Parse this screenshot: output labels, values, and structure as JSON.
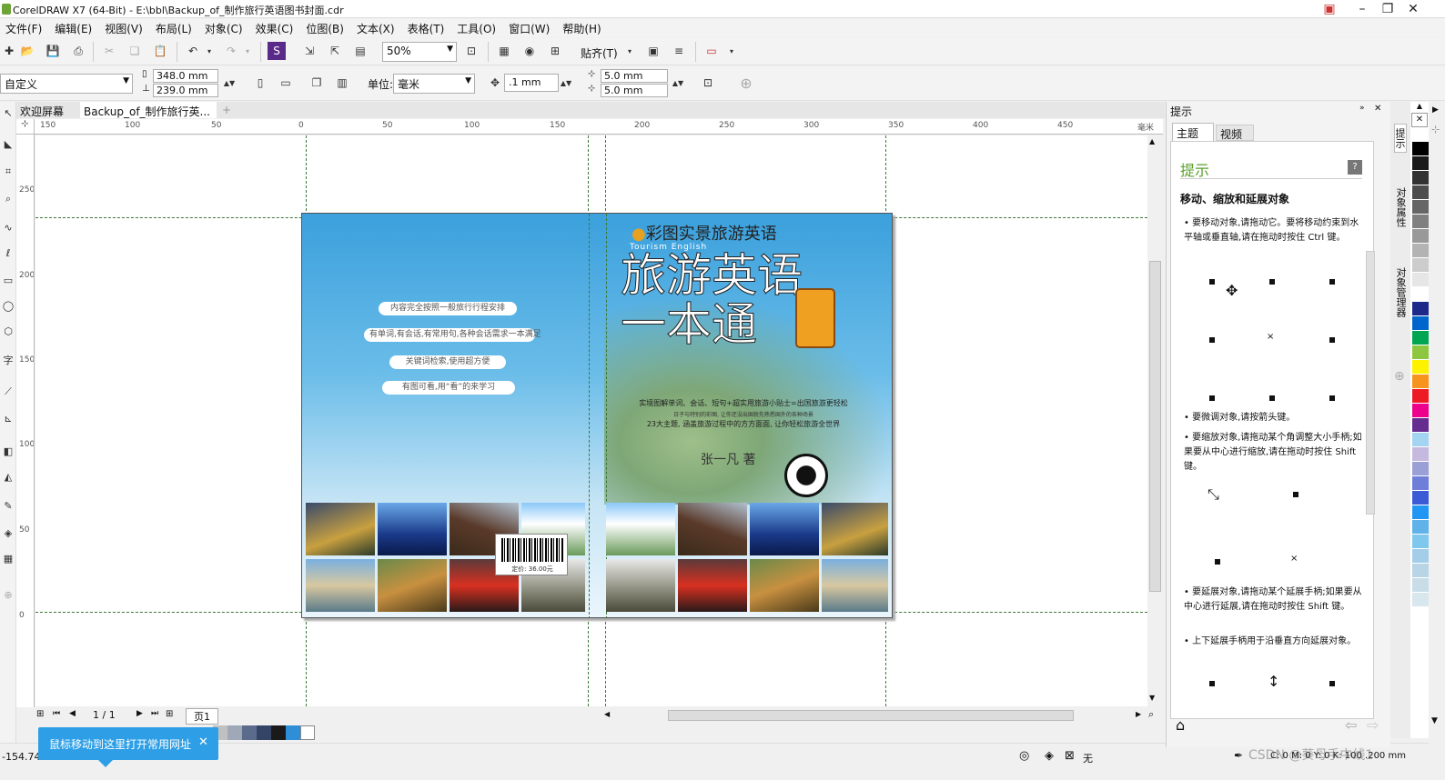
{
  "window": {
    "title": "CorelDRAW X7 (64-Bit) - E:\\bbl\\Backup_of_制作旅行英语图书封面.cdr"
  },
  "menu": [
    "文件(F)",
    "编辑(E)",
    "视图(V)",
    "布局(L)",
    "对象(C)",
    "效果(C)",
    "位图(B)",
    "文本(X)",
    "表格(T)",
    "工具(O)",
    "窗口(W)",
    "帮助(H)"
  ],
  "toolbar1": {
    "zoom": "50%",
    "snap_label": "贴齐(T)"
  },
  "toolbar2": {
    "page_preset": "自定义",
    "width": "348.0 mm",
    "height": "239.0 mm",
    "units_label": "单位:",
    "units_value": "毫米",
    "nudge": ".1 mm",
    "dup_x": "5.0 mm",
    "dup_y": "5.0 mm"
  },
  "doc_tabs": [
    "欢迎屏幕",
    "Backup_of_制作旅行英..."
  ],
  "hruler_labels": [
    "150",
    "100",
    "50",
    "0",
    "50",
    "100",
    "150",
    "200",
    "250",
    "300",
    "350",
    "400",
    "450"
  ],
  "hruler_unit": "毫米",
  "vruler_labels": [
    "250",
    "200",
    "150",
    "100",
    "50",
    "0"
  ],
  "cover": {
    "back_pills": [
      "内容完全按照一般旅行行程安排",
      "有单词,有会话,有常用句,各种会话需求一本满足",
      "关键词检索,使用超方便",
      "有图可看,用“看”的来学习"
    ],
    "price": "定价: 36.00元",
    "series": "彩图实景旅游英语",
    "subtitle_en": "Tourism English",
    "title_line1": "旅游英语",
    "title_line2": "一本通",
    "desc1": "实境图解单词、会话、短句+超实用旅游小贴士=出国旅游更轻松",
    "desc2": "日子与特别的彩图, 让你还没出国就先熟悉国外的各种场景",
    "desc3": "23大主题, 涵盖旅游过程中的方方面面, 让你轻松旅游全世界",
    "author": "张一凡  著"
  },
  "page_nav": {
    "current": "1 / 1",
    "tab": "页1"
  },
  "docker": {
    "header": "提示",
    "tabs": [
      "主题",
      "视频"
    ],
    "section": "提示",
    "heading": "移动、缩放和延展对象",
    "p1": "要移动对象,请拖动它。要将移动约束到水平轴或垂直轴,请在拖动时按住 Ctrl 键。",
    "p2": "要微调对象,请按箭头键。",
    "p3": "要缩放对象,请拖动某个角调整大小手柄;如果要从中心进行缩放,请在拖动时按住 Shift 键。",
    "p4": "要延展对象,请拖动某个延展手柄;如果要从中心进行延展,请在拖动时按住 Shift 键。",
    "p5": "上下延展手柄用于沿垂直方向延展对象。"
  },
  "dock_side_tabs": [
    "提示",
    "对象属性",
    "对象管理器"
  ],
  "status": {
    "coords": "-154.743",
    "fill_label": "无",
    "outline": "C: 0 M: 0 Y: 0 K: 100  .200 mm",
    "watermark": "CSDN @葵母手中线1"
  },
  "tooltip": "鼠标移动到这里打开常用网址",
  "colors": {
    "accent": "#2e9fe6",
    "cover_sky": "#3ba0dc"
  },
  "palette": [
    "#ffffff",
    "#000000",
    "#1a1a1a",
    "#333333",
    "#4d4d4d",
    "#666666",
    "#808080",
    "#999999",
    "#b3b3b3",
    "#cccccc",
    "#e6e6e6",
    "#ffffff",
    "#1e2a8a",
    "#0066cc",
    "#00a651",
    "#8dc63f",
    "#fff200",
    "#f7941d",
    "#ed1c24",
    "#ec008c",
    "#662d91",
    "#a3d5f2",
    "#c6b9df",
    "#9aa0d6",
    "#6f7ed8",
    "#3b5ad6",
    "#2196f3",
    "#5fb3e8",
    "#7fc7ec",
    "#a3cde8",
    "#b7d5e4",
    "#c8dde8",
    "#d8e6ee"
  ],
  "mini_palette": [
    "#c0c0c0",
    "#a0a8b8",
    "#5a6b8c",
    "#334466",
    "#1a1a1a",
    "#2e8fd8",
    "#ffffff"
  ]
}
